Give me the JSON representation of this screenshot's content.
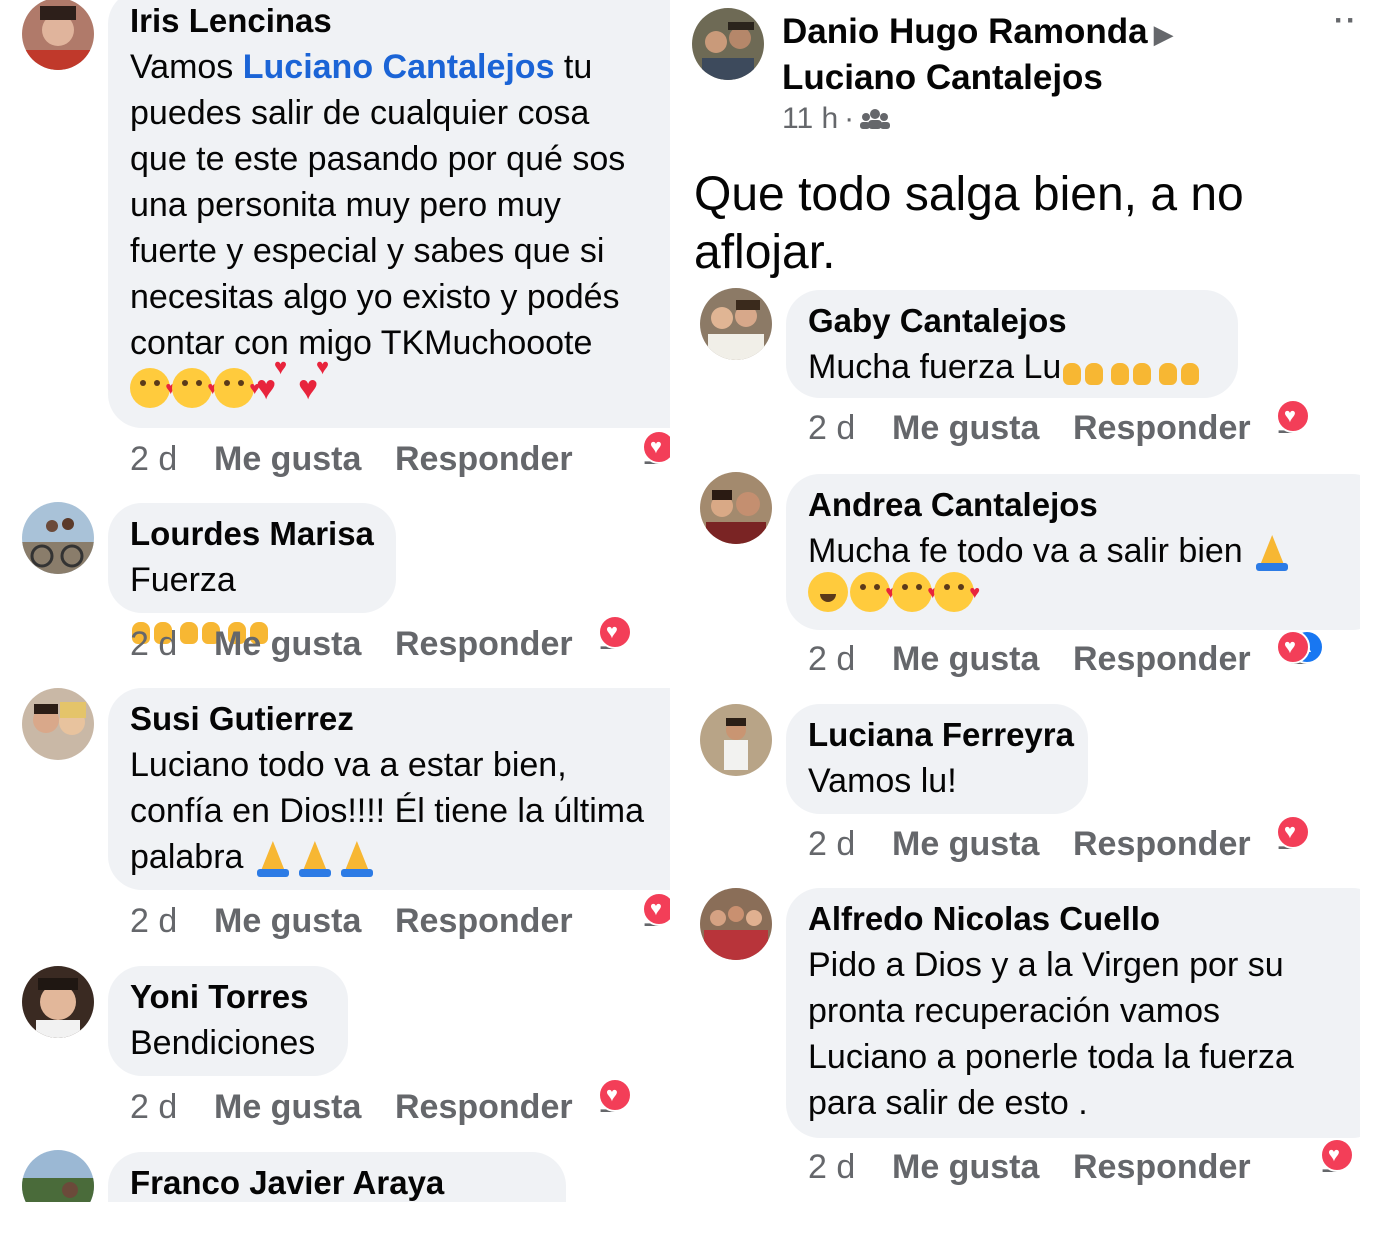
{
  "colors": {
    "bubble": "#f0f2f5",
    "mention": "#1b64d6",
    "meta": "#65676b",
    "love": "#f33e58",
    "like": "#1877f2"
  },
  "left_comments": [
    {
      "author": "Iris Lencinas",
      "mention": "Luciano Cantalejos",
      "text_before": "Vamos ",
      "text_after": " tu\npuedes salir de cualquier cosa\nque te este pasando por qué sos\nuna personita muy pero muy\nfuerte y especial y sabes que si\nnecesitas algo yo existo y podés\ncontar con migo TKMuchooote",
      "time": "2 d",
      "like": "Me gusta",
      "reply": "Responder",
      "reactions": "1"
    },
    {
      "author": "Lourdes Marisa",
      "text": "Fuerza",
      "time": "2 d",
      "like": "Me gusta",
      "reply": "Responder",
      "reactions": "1"
    },
    {
      "author": "Susi Gutierrez",
      "text": "Luciano todo va a estar bien,\nconfía en Dios!!!! Él tiene la última\npalabra ",
      "time": "2 d",
      "like": "Me gusta",
      "reply": "Responder",
      "reactions": "1"
    },
    {
      "author": "Yoni Torres",
      "text": "Bendiciones",
      "time": "2 d",
      "like": "Me gusta",
      "reply": "Responder",
      "reactions": "1"
    },
    {
      "author": "Franco Javier Araya"
    }
  ],
  "post": {
    "author": "Danio Hugo Ramonda",
    "target": "Luciano Cantalejos",
    "time": "11 h",
    "separator": "·",
    "audience_icon": "group-icon",
    "more_icon": "more-dots-icon",
    "text": "Que todo salga bien, a no\naflojar."
  },
  "right_comments": [
    {
      "author": "Gaby Cantalejos",
      "text": "Mucha fuerza Lu",
      "time": "2 d",
      "like": "Me gusta",
      "reply": "Responder",
      "reactions": "1"
    },
    {
      "author": "Andrea Cantalejos",
      "text": "Mucha fe todo va a salir bien ",
      "time": "2 d",
      "like": "Me gusta",
      "reply": "Responder",
      "reactions": "2"
    },
    {
      "author": "Luciana Ferreyra",
      "text": "Vamos lu!",
      "time": "2 d",
      "like": "Me gusta",
      "reply": "Responder",
      "reactions": "1"
    },
    {
      "author": "Alfredo Nicolas Cuello",
      "text": "Pido a Dios y a la Virgen por su\npronta recuperación vamos\nLuciano a ponerle toda la fuerza\npara salir de esto .",
      "time": "2 d",
      "like": "Me gusta",
      "reply": "Responder",
      "reactions": "1"
    }
  ]
}
